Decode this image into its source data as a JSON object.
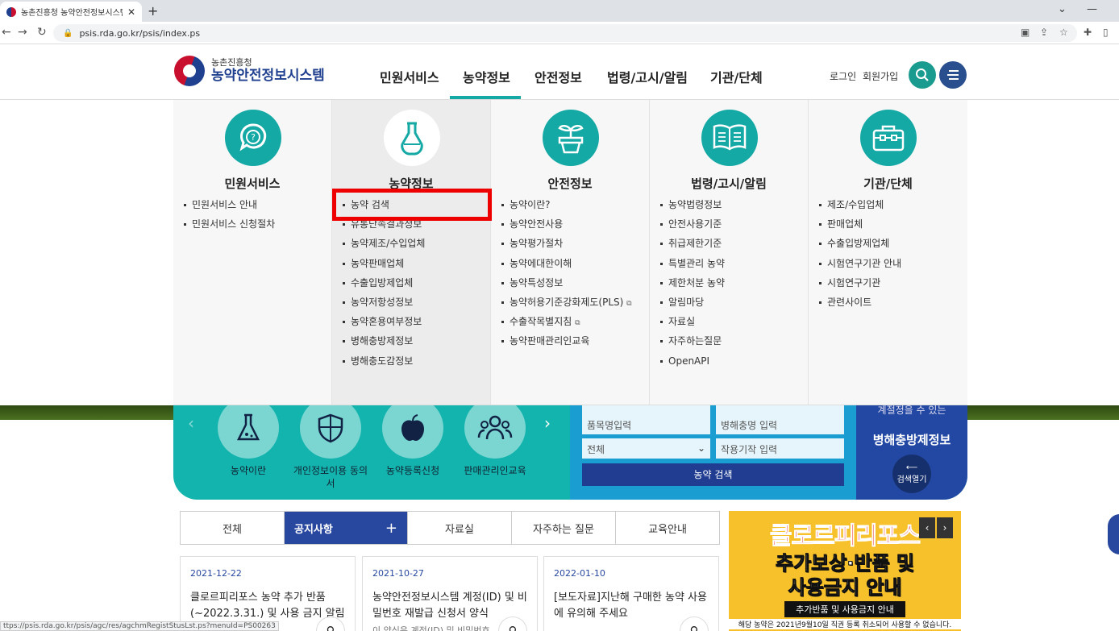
{
  "browser": {
    "tab_title": "농촌진흥청 농약안전정보시스템",
    "tab_close": "✕",
    "new_tab": "+",
    "url": "psis.rda.go.kr/psis/index.ps",
    "status_url": "ttps://psis.rda.go.kr/psis/agc/res/agchmRegistStusLst.ps?menuId=PS00263"
  },
  "header": {
    "logo_small": "농촌진흥청",
    "logo_big": "농약안전정보시스템",
    "nav": [
      "민원서비스",
      "농약정보",
      "안전정보",
      "법령/고시/알림",
      "기관/단체"
    ],
    "active_nav": "농약정보",
    "login": "로그인",
    "signup": "회원가입",
    "search_color": "#1a9b8f",
    "menu_color": "#2a4f8f"
  },
  "mega_menu": [
    {
      "title": "민원서비스",
      "icon": "question-icon",
      "items": [
        "민원서비스 안내",
        "민원서비스 신청절차"
      ]
    },
    {
      "title": "농약정보",
      "icon": "flask-icon",
      "items": [
        "농약 검색",
        "유통단속결과정보",
        "농약제조/수입업체",
        "농약판매업체",
        "수출입방제업체",
        "농약저항성정보",
        "농약혼용여부정보",
        "병해충방제정보",
        "병해충도감정보"
      ]
    },
    {
      "title": "안전정보",
      "icon": "sprout-icon",
      "items": [
        "농약이란?",
        "농약안전사용",
        "농약평가절차",
        "농약에대한이해",
        "농약특성정보",
        "농약허용기준강화제도(PLS)",
        "수출작목별지침",
        "농약판매관리인교육"
      ]
    },
    {
      "title": "법령/고시/알림",
      "icon": "book-icon",
      "items": [
        "농약법령정보",
        "안전사용기준",
        "취급제한기준",
        "특별관리 농약",
        "제한처분 농약",
        "알림마당",
        "자료실",
        "자주하는질문",
        "OpenAPI"
      ]
    },
    {
      "title": "기관/단체",
      "icon": "toolbox-icon",
      "items": [
        "제조/수입업체",
        "판매업체",
        "수출입방제업체",
        "시험연구기관 안내",
        "시험연구기관",
        "관련사이트"
      ]
    }
  ],
  "external_mark": "⧉",
  "quick": {
    "items": [
      {
        "label": "농약이란",
        "icon": "beaker-icon"
      },
      {
        "label": "개인정보이용 동의서",
        "icon": "shield-icon"
      },
      {
        "label": "농약등록신청",
        "icon": "apple-icon"
      },
      {
        "label": "판매관리인교육",
        "icon": "people-icon"
      }
    ],
    "prev": "‹",
    "next": "›",
    "search": {
      "product_placeholder": "품목명입력",
      "pest_placeholder": "병해충명 입력",
      "select_value": "전체",
      "crop_placeholder": "작용기작 입력",
      "button": "농약 검색"
    },
    "right_panel": {
      "top_text": "계절정을 수 있는",
      "title": "병해충방제정보",
      "button": "검색열기"
    }
  },
  "board": {
    "tabs": [
      "전체",
      "공지사항",
      "자료실",
      "자주하는 질문",
      "교육안내"
    ],
    "active_tab": "공지사항",
    "plus": "+",
    "cards": [
      {
        "date": "2021-12-22",
        "title": "클로르피리포스 농약 추가 반품 (~2022.3.31.) 및 사용 금지 알림",
        "sub": ""
      },
      {
        "date": "2021-10-27",
        "title": "농약안전정보시스템 계정(ID) 및 비밀번호 재발급 신청서 양식",
        "sub": "이 양식은 계정(ID) 및 비밀번호"
      },
      {
        "date": "2022-01-10",
        "title": "[보도자료]지난해 구매한 농약 사용에 유의해 주세요",
        "sub": ""
      }
    ]
  },
  "banner": {
    "line1": "클로르피리포스",
    "line2": "추가보상·반품 및",
    "line3": "사용금지 안내",
    "line4": "추가반품 및 사용금지 안내",
    "line5": "해당 농약은 2021년9월10일 직권 등록 취소되어 사용할 수 없습니다.",
    "prev": "‹",
    "next": "›"
  }
}
